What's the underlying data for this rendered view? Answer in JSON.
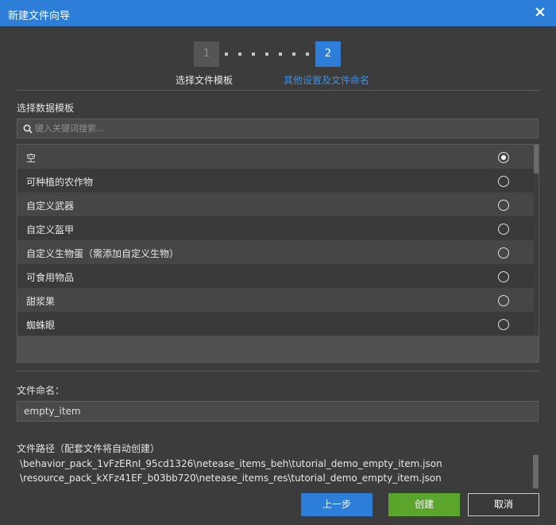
{
  "window": {
    "title": "新建文件向导"
  },
  "steps": [
    {
      "number": "1",
      "label": "选择文件模板"
    },
    {
      "number": "2",
      "label": "其他设置及文件命名"
    }
  ],
  "template_section": {
    "label": "选择数据模板",
    "search_placeholder": "键入关键词搜索...",
    "items": [
      {
        "label": "空",
        "selected": true
      },
      {
        "label": "可种植的农作物",
        "selected": false
      },
      {
        "label": "自定义武器",
        "selected": false
      },
      {
        "label": "自定义盔甲",
        "selected": false
      },
      {
        "label": "自定义生物蛋（需添加自定义生物）",
        "selected": false
      },
      {
        "label": "可食用物品",
        "selected": false
      },
      {
        "label": "甜浆果",
        "selected": false
      },
      {
        "label": "蜘蛛眼",
        "selected": false
      }
    ]
  },
  "file_name": {
    "label": "文件命名：",
    "value": "empty_item"
  },
  "file_path": {
    "label": "文件路径（配套文件将自动创建）",
    "lines": [
      "\\behavior_pack_1vFzERnI_95cd1326\\netease_items_beh\\tutorial_demo_empty_item.json",
      "\\resource_pack_kXFz41EF_b03bb720\\netease_items_res\\tutorial_demo_empty_item.json"
    ]
  },
  "buttons": {
    "prev": "上一步",
    "create": "创建",
    "cancel": "取消"
  },
  "colors": {
    "accent": "#2d7ed8",
    "create": "#5ba52c",
    "background": "#3c3c3c"
  }
}
